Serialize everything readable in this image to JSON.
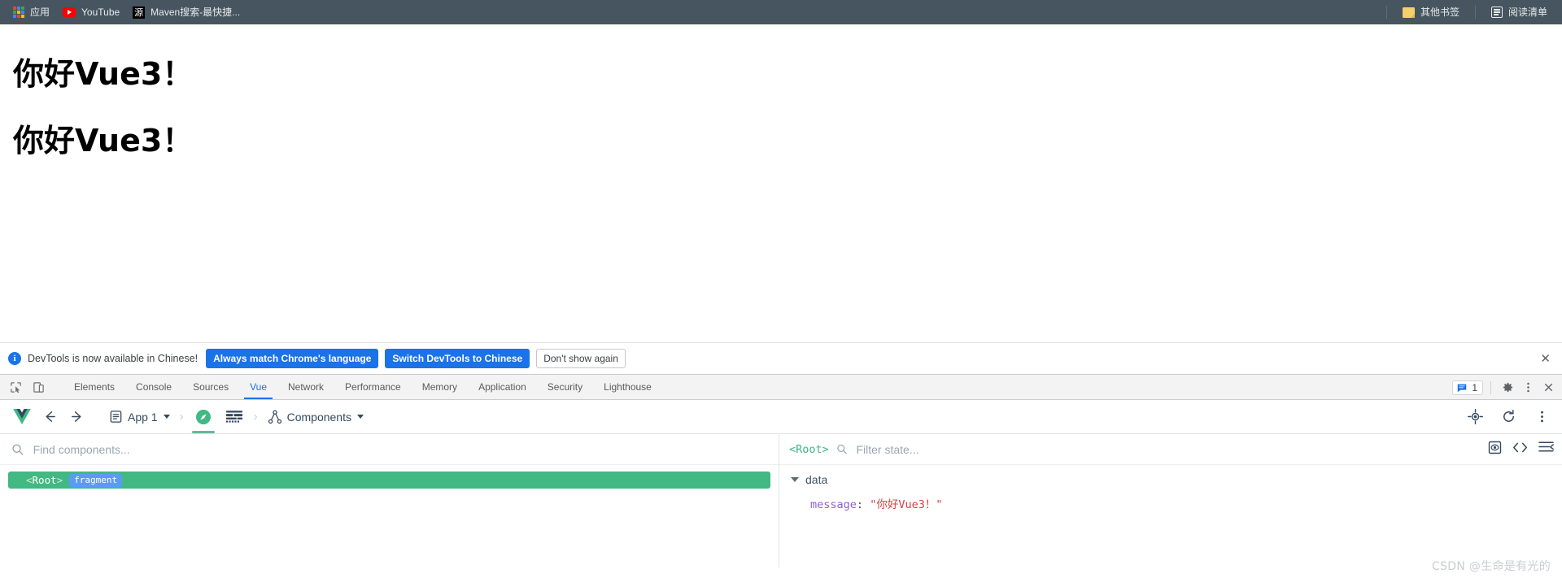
{
  "bookmark_bar": {
    "items": [
      {
        "label": "应用",
        "icon": "apps-grid-icon"
      },
      {
        "label": "YouTube",
        "icon": "youtube-icon"
      },
      {
        "label": "Maven搜索-最快捷...",
        "icon": "maven-source-icon",
        "favicon_text": "源"
      }
    ],
    "right_items": [
      {
        "label": "其他书签",
        "icon": "folder-icon"
      },
      {
        "label": "阅读清单",
        "icon": "reading-list-icon"
      }
    ]
  },
  "page": {
    "heading_1": "你好Vue3！",
    "heading_2": "你好Vue3！"
  },
  "notice": {
    "icon": "info-icon",
    "text": "DevTools is now available in Chinese!",
    "primary_button": "Always match Chrome's language",
    "secondary_button": "Switch DevTools to Chinese",
    "dismiss_button": "Don't show again",
    "close_icon": "✕",
    "accent_color": "#1a73e8"
  },
  "devtools_tabs": {
    "left_icons": [
      "inspect-element-icon",
      "device-toolbar-icon"
    ],
    "tabs": [
      {
        "label": "Elements",
        "active": false
      },
      {
        "label": "Console",
        "active": false
      },
      {
        "label": "Sources",
        "active": false
      },
      {
        "label": "Vue",
        "active": true
      },
      {
        "label": "Network",
        "active": false
      },
      {
        "label": "Performance",
        "active": false
      },
      {
        "label": "Memory",
        "active": false
      },
      {
        "label": "Application",
        "active": false
      },
      {
        "label": "Security",
        "active": false
      },
      {
        "label": "Lighthouse",
        "active": false
      }
    ],
    "message_count": "1",
    "right_icons": [
      "messages-icon",
      "settings-gear-icon",
      "more-vertical-icon",
      "close-devtools-icon"
    ],
    "active_color": "#1a73e8"
  },
  "vue_toolbar": {
    "logo": "vue-logo-icon",
    "back_icon": "arrow-left-icon",
    "forward_icon": "arrow-right-icon",
    "app_selector": "App 1",
    "app_icon": "app-document-icon",
    "crumb_separator": "›",
    "inspector_icon": "compass-icon",
    "timeline_icon": "timeline-icon",
    "view_selector": "Components",
    "view_icon": "component-tree-icon",
    "right_icons": [
      "select-component-icon",
      "refresh-icon",
      "more-vertical-icon"
    ],
    "accent_color": "#42b883"
  },
  "component_tree": {
    "search_placeholder": "Find components...",
    "search_value": "",
    "search_icon": "search-icon",
    "nodes": [
      {
        "tag_open": "<",
        "name": "Root",
        "tag_close": ">",
        "badge": "fragment",
        "selected": true
      }
    ]
  },
  "state_panel": {
    "root_label": "<Root>",
    "filter_placeholder": "Filter state...",
    "filter_value": "",
    "search_icon": "search-icon",
    "right_icons": [
      "inspect-dom-icon",
      "open-in-editor-icon",
      "collapse-all-icon"
    ],
    "groups": [
      {
        "name": "data",
        "expanded": true,
        "entries": [
          {
            "key": "message",
            "separator": ":",
            "value": "\"你好Vue3！\""
          }
        ]
      }
    ]
  },
  "watermark": "CSDN @生命是有光的"
}
